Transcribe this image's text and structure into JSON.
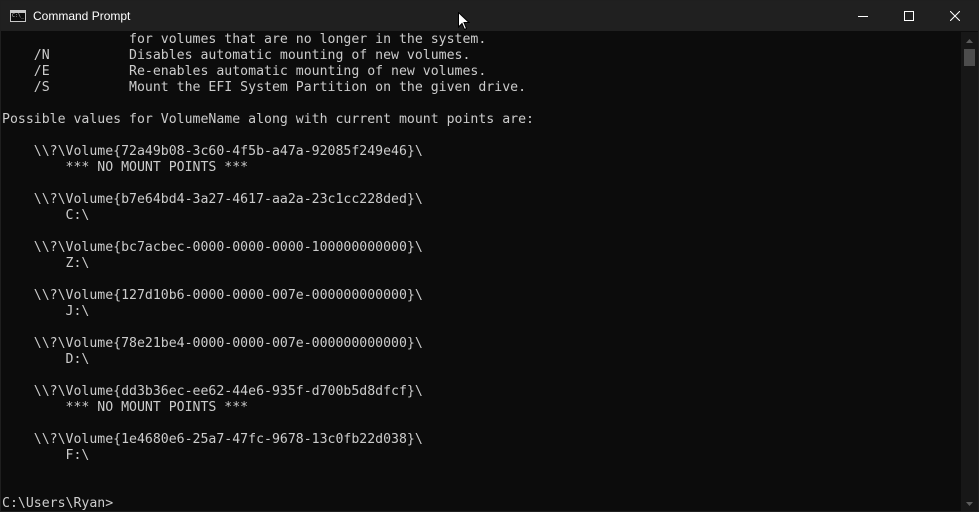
{
  "window": {
    "title": "Command Prompt"
  },
  "caption": {
    "minimize_icon": "minimize-icon",
    "maximize_icon": "maximize-icon",
    "close_icon": "close-icon"
  },
  "console": {
    "lines": [
      "                for volumes that are no longer in the system.",
      "    /N          Disables automatic mounting of new volumes.",
      "    /E          Re-enables automatic mounting of new volumes.",
      "    /S          Mount the EFI System Partition on the given drive.",
      "",
      "Possible values for VolumeName along with current mount points are:",
      "",
      "    \\\\?\\Volume{72a49b08-3c60-4f5b-a47a-92085f249e46}\\",
      "        *** NO MOUNT POINTS ***",
      "",
      "    \\\\?\\Volume{b7e64bd4-3a27-4617-aa2a-23c1cc228ded}\\",
      "        C:\\",
      "",
      "    \\\\?\\Volume{bc7acbec-0000-0000-0000-100000000000}\\",
      "        Z:\\",
      "",
      "    \\\\?\\Volume{127d10b6-0000-0000-007e-000000000000}\\",
      "        J:\\",
      "",
      "    \\\\?\\Volume{78e21be4-0000-0000-007e-000000000000}\\",
      "        D:\\",
      "",
      "    \\\\?\\Volume{dd3b36ec-ee62-44e6-935f-d700b5d8dfcf}\\",
      "        *** NO MOUNT POINTS ***",
      "",
      "    \\\\?\\Volume{1e4680e6-25a7-47fc-9678-13c0fb22d038}\\",
      "        F:\\",
      "",
      "",
      "C:\\Users\\Ryan>"
    ]
  },
  "colors": {
    "console_bg": "#0c0c0c",
    "console_fg": "#cccccc",
    "titlebar_bg": "#202020"
  }
}
